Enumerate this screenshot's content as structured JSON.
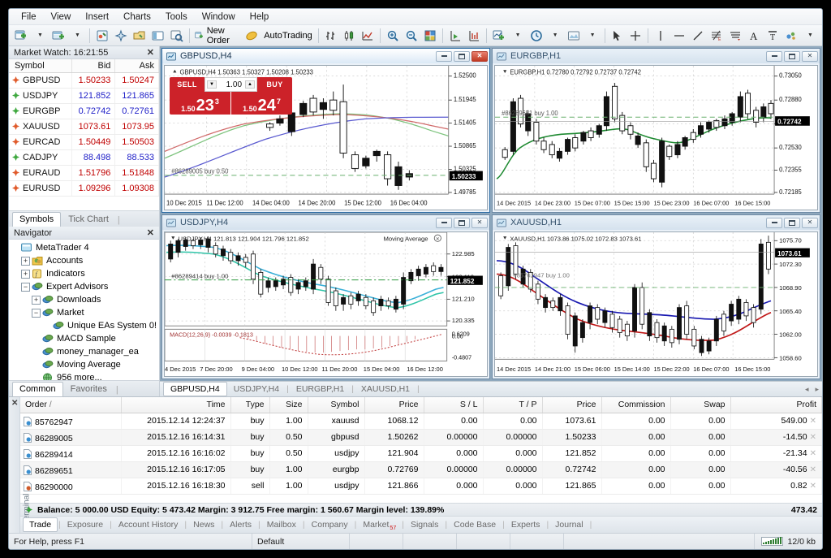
{
  "menu": [
    "File",
    "View",
    "Insert",
    "Charts",
    "Tools",
    "Window",
    "Help"
  ],
  "toolbar": {
    "new_chart": "new-chart-icon",
    "profiles": "profiles-icon",
    "market_watch": "market-watch-icon",
    "navigator": "navigator-icon",
    "data_window": "data-window-icon",
    "terminal": "terminal-icon",
    "strategy_tester": "strategy-tester-icon",
    "new_order_label": "New Order",
    "metaeditor": "metaeditor-icon",
    "autotrading_label": "AutoTrading",
    "bar_chart": "bar-chart-icon",
    "candle_chart": "candlestick-chart-icon",
    "line_chart": "line-chart-icon",
    "zoom_in": "zoom-in-icon",
    "zoom_out": "zoom-out-icon",
    "tile_windows": "tile-windows-icon",
    "chart_shift": "chart-shift-icon",
    "auto_scroll": "auto-scroll-icon",
    "indicators": "indicators-icon",
    "periods": "periods-clock-icon",
    "templates": "templates-icon",
    "cursor": "cursor-arrow-icon",
    "crosshair": "crosshair-icon",
    "vline": "vertical-line-icon",
    "hline": "horizontal-line-icon",
    "trendline": "trendline-icon",
    "fibonacci": "fibonacci-icon",
    "equidistant": "equidistant-channel-icon",
    "text": "text-icon",
    "text_label": "text-label-icon",
    "shapes": "shapes-icon"
  },
  "market_watch": {
    "title": "Market Watch: 16:21:55",
    "columns": [
      "Symbol",
      "Bid",
      "Ask"
    ],
    "rows": [
      {
        "symbol": "GBPUSD",
        "bid": "1.50233",
        "ask": "1.50247",
        "dir": "up"
      },
      {
        "symbol": "USDJPY",
        "bid": "121.852",
        "ask": "121.865",
        "dir": "down"
      },
      {
        "symbol": "EURGBP",
        "bid": "0.72742",
        "ask": "0.72761",
        "dir": "down"
      },
      {
        "symbol": "XAUUSD",
        "bid": "1073.61",
        "ask": "1073.95",
        "dir": "up"
      },
      {
        "symbol": "EURCAD",
        "bid": "1.50449",
        "ask": "1.50503",
        "dir": "up"
      },
      {
        "symbol": "CADJPY",
        "bid": "88.498",
        "ask": "88.533",
        "dir": "down"
      },
      {
        "symbol": "EURAUD",
        "bid": "1.51796",
        "ask": "1.51848",
        "dir": "up"
      },
      {
        "symbol": "EURUSD",
        "bid": "1.09296",
        "ask": "1.09308",
        "dir": "up"
      }
    ],
    "tabs": [
      {
        "label": "Symbols",
        "active": true
      },
      {
        "label": "Tick Chart",
        "active": false
      }
    ]
  },
  "navigator": {
    "title": "Navigator",
    "tree": [
      {
        "label": "MetaTrader 4",
        "indent": 0,
        "expander": "none",
        "icon": "terminal-root-icon"
      },
      {
        "label": "Accounts",
        "indent": 1,
        "expander": "plus",
        "icon": "accounts-icon"
      },
      {
        "label": "Indicators",
        "indent": 1,
        "expander": "plus",
        "icon": "indicators-icon"
      },
      {
        "label": "Expert Advisors",
        "indent": 1,
        "expander": "minus",
        "icon": "expert-icon"
      },
      {
        "label": "Downloads",
        "indent": 2,
        "expander": "plus",
        "icon": "expert-icon"
      },
      {
        "label": "Market",
        "indent": 2,
        "expander": "minus",
        "icon": "expert-icon"
      },
      {
        "label": "Unique EAs System 0!",
        "indent": 3,
        "expander": "none",
        "icon": "expert-icon"
      },
      {
        "label": "MACD Sample",
        "indent": 2,
        "expander": "none",
        "icon": "expert-icon"
      },
      {
        "label": "money_manager_ea",
        "indent": 2,
        "expander": "none",
        "icon": "expert-icon"
      },
      {
        "label": "Moving Average",
        "indent": 2,
        "expander": "none",
        "icon": "expert-icon"
      },
      {
        "label": "956 more...",
        "indent": 2,
        "expander": "none",
        "icon": "globe-icon"
      },
      {
        "label": "Scripts",
        "indent": 1,
        "expander": "plus",
        "icon": "scripts-icon"
      }
    ],
    "tabs": [
      {
        "label": "Common",
        "active": true
      },
      {
        "label": "Favorites",
        "active": false
      }
    ]
  },
  "charts": [
    {
      "title": "GBPUSD,H4",
      "active": true,
      "header": "GBPUSD,H4  1.50363 1.50327 1.50208 1.50233",
      "order_label": "#86289005 buy 0.50",
      "current_price": "1.50233",
      "y_ticks": [
        "1.52500",
        "1.51945",
        "1.51405",
        "1.50865",
        "1.50325",
        "1.49785"
      ],
      "x_ticks": [
        "10 Dec 2015",
        "11 Dec 12:00",
        "14 Dec 04:00",
        "14 Dec 20:00",
        "15 Dec 12:00",
        "16 Dec 04:00"
      ],
      "one_click": {
        "sell_label": "SELL",
        "buy_label": "BUY",
        "volume": "1.00",
        "sell_big": "23",
        "sell_sup": "3",
        "sell_pre": "1.50",
        "buy_big": "24",
        "buy_sup": "7",
        "buy_pre": "1.50"
      }
    },
    {
      "title": "EURGBP,H1",
      "active": false,
      "header": "EURGBP,H1  0.72780 0.72792 0.72737 0.72742",
      "order_label": "#86289651 buy 1.00",
      "current_price": "0.72742",
      "y_ticks": [
        "0.73050",
        "0.72880",
        "0.72705",
        "0.72530",
        "0.72355",
        "0.72185"
      ],
      "x_ticks": [
        "14 Dec 2015",
        "14 Dec 23:00",
        "15 Dec 07:00",
        "15 Dec 15:00",
        "15 Dec 23:00",
        "16 Dec 07:00",
        "16 Dec 15:00"
      ]
    },
    {
      "title": "USDJPY,H4",
      "active": false,
      "header": "USDJPY,H4  121.813 121.904 121.796 121.852",
      "indicator_label": "Moving Average",
      "order_label": "#86289414 buy 1.00",
      "current_price": "121.852",
      "y_ticks": [
        "122.985",
        "122.110",
        "121.210",
        "120.335"
      ],
      "sub_indicator": "MACD(12,26,9) -0.0039 -0.1813",
      "sub_y_ticks": [
        "0.6209",
        "0.00",
        "-0.4807"
      ],
      "x_ticks": [
        "4 Dec 2015",
        "7 Dec 20:00",
        "9 Dec 04:00",
        "10 Dec 12:00",
        "11 Dec 20:00",
        "15 Dec 04:00",
        "16 Dec 12:00"
      ]
    },
    {
      "title": "XAUUSD,H1",
      "active": false,
      "header": "XAUUSD,H1  1073.86 1075.02 1072.83 1073.61",
      "order_label": "#85762947 buy 1.00",
      "current_price": "1073.61",
      "y_ticks": [
        "1075.70",
        "1072.30",
        "1068.90",
        "1065.40",
        "1062.00",
        "1058.60"
      ],
      "x_ticks": [
        "14 Dec 2015",
        "14 Dec 21:00",
        "15 Dec 06:00",
        "15 Dec 14:00",
        "15 Dec 22:00",
        "16 Dec 07:00",
        "16 Dec 15:00"
      ]
    }
  ],
  "chart_tabs": [
    {
      "label": "GBPUSD,H4",
      "active": true
    },
    {
      "label": "USDJPY,H4",
      "active": false
    },
    {
      "label": "EURGBP,H1",
      "active": false
    },
    {
      "label": "XAUUSD,H1",
      "active": false
    }
  ],
  "terminal": {
    "vertical_label": "Terminal",
    "columns": [
      "Order",
      "Time",
      "Type",
      "Size",
      "Symbol",
      "Price",
      "S / L",
      "T / P",
      "Price",
      "Commission",
      "Swap",
      "Profit"
    ],
    "sort_column": "Order",
    "rows": [
      {
        "order": "85762947",
        "time": "2015.12.14 12:24:37",
        "type": "buy",
        "size": "1.00",
        "symbol": "xauusd",
        "price": "1068.12",
        "sl": "0.00",
        "tp": "0.00",
        "price2": "1073.61",
        "commission": "0.00",
        "swap": "0.00",
        "profit": "549.00",
        "dir": "buy"
      },
      {
        "order": "86289005",
        "time": "2015.12.16 16:14:31",
        "type": "buy",
        "size": "0.50",
        "symbol": "gbpusd",
        "price": "1.50262",
        "sl": "0.00000",
        "tp": "0.00000",
        "price2": "1.50233",
        "commission": "0.00",
        "swap": "0.00",
        "profit": "-14.50",
        "dir": "buy"
      },
      {
        "order": "86289414",
        "time": "2015.12.16 16:16:02",
        "type": "buy",
        "size": "0.50",
        "symbol": "usdjpy",
        "price": "121.904",
        "sl": "0.000",
        "tp": "0.000",
        "price2": "121.852",
        "commission": "0.00",
        "swap": "0.00",
        "profit": "-21.34",
        "dir": "buy"
      },
      {
        "order": "86289651",
        "time": "2015.12.16 16:17:05",
        "type": "buy",
        "size": "1.00",
        "symbol": "eurgbp",
        "price": "0.72769",
        "sl": "0.00000",
        "tp": "0.00000",
        "price2": "0.72742",
        "commission": "0.00",
        "swap": "0.00",
        "profit": "-40.56",
        "dir": "buy"
      },
      {
        "order": "86290000",
        "time": "2015.12.16 16:18:30",
        "type": "sell",
        "size": "1.00",
        "symbol": "usdjpy",
        "price": "121.866",
        "sl": "0.000",
        "tp": "0.000",
        "price2": "121.865",
        "commission": "0.00",
        "swap": "0.00",
        "profit": "0.82",
        "dir": "sell"
      }
    ],
    "balance_line": "Balance: 5 000.00 USD  Equity: 5 473.42  Margin: 3 912.75  Free margin: 1 560.67  Margin level: 139.89%",
    "balance_total": "473.42",
    "tabs": [
      {
        "label": "Trade",
        "active": true,
        "badge": ""
      },
      {
        "label": "Exposure",
        "active": false,
        "badge": ""
      },
      {
        "label": "Account History",
        "active": false,
        "badge": ""
      },
      {
        "label": "News",
        "active": false,
        "badge": ""
      },
      {
        "label": "Alerts",
        "active": false,
        "badge": ""
      },
      {
        "label": "Mailbox",
        "active": false,
        "badge": ""
      },
      {
        "label": "Company",
        "active": false,
        "badge": ""
      },
      {
        "label": "Market",
        "active": false,
        "badge": "57"
      },
      {
        "label": "Signals",
        "active": false,
        "badge": ""
      },
      {
        "label": "Code Base",
        "active": false,
        "badge": ""
      },
      {
        "label": "Experts",
        "active": false,
        "badge": ""
      },
      {
        "label": "Journal",
        "active": false,
        "badge": ""
      }
    ]
  },
  "status": {
    "help": "For Help, press F1",
    "profile": "Default",
    "traffic": "12/0 kb",
    "signal_icon": "signal-bars-icon"
  },
  "colors": {
    "accent": "#2f6ea5",
    "sell_red": "#cc2229",
    "bid_up": "#c00000",
    "bid_down": "#2020c8",
    "grid": "#cccccc"
  },
  "chart_data": {
    "type": "candlestick-multi",
    "panels": [
      {
        "name": "GBPUSD,H4",
        "ylim": [
          1.49785,
          1.525
        ],
        "yticks": [
          1.49785,
          1.50325,
          1.50865,
          1.51405,
          1.51945,
          1.525
        ],
        "xticks": [
          "10 Dec 2015",
          "11 Dec 12:00",
          "14 Dec 04:00",
          "14 Dec 20:00",
          "15 Dec 12:00",
          "16 Dec 04:00"
        ],
        "ohlc": "1.50363 1.50327 1.50208 1.50233",
        "last": 1.50233,
        "overlays": [
          "MA green",
          "MA red",
          "MA blue"
        ],
        "order_line": 1.50262
      },
      {
        "name": "EURGBP,H1",
        "ylim": [
          0.72185,
          0.7305
        ],
        "yticks": [
          0.72185,
          0.72355,
          0.7253,
          0.72705,
          0.7288,
          0.7305
        ],
        "xticks": [
          "14 Dec 2015",
          "14 Dec 23:00",
          "15 Dec 07:00",
          "15 Dec 15:00",
          "15 Dec 23:00",
          "16 Dec 07:00",
          "16 Dec 15:00"
        ],
        "ohlc": "0.72780 0.72792 0.72737 0.72742",
        "last": 0.72742,
        "overlays": [
          "MA green"
        ],
        "order_line": 0.72769
      },
      {
        "name": "USDJPY,H4",
        "ylim": [
          120.335,
          122.985
        ],
        "yticks": [
          120.335,
          121.21,
          122.11,
          122.985
        ],
        "xticks": [
          "4 Dec 2015",
          "7 Dec 20:00",
          "9 Dec 04:00",
          "10 Dec 12:00",
          "11 Dec 20:00",
          "15 Dec 04:00",
          "16 Dec 12:00"
        ],
        "ohlc": "121.813 121.904 121.796 121.852",
        "last": 121.852,
        "overlays": [
          "MA cyan",
          "MA teal"
        ],
        "order_line": 121.904,
        "subplot": {
          "name": "MACD(12,26,9)",
          "values": "-0.0039 -0.1813",
          "ylim": [
            -0.4807,
            0.6209
          ]
        }
      },
      {
        "name": "XAUUSD,H1",
        "ylim": [
          1058.6,
          1075.7
        ],
        "yticks": [
          1058.6,
          1062.0,
          1065.4,
          1068.9,
          1072.3,
          1075.7
        ],
        "xticks": [
          "14 Dec 2015",
          "14 Dec 21:00",
          "15 Dec 06:00",
          "15 Dec 14:00",
          "15 Dec 22:00",
          "16 Dec 07:00",
          "16 Dec 15:00"
        ],
        "ohlc": "1073.86 1075.02 1072.83 1073.61",
        "last": 1073.61,
        "overlays": [
          "MA blue",
          "MA red"
        ],
        "order_line": 1068.12
      }
    ]
  }
}
